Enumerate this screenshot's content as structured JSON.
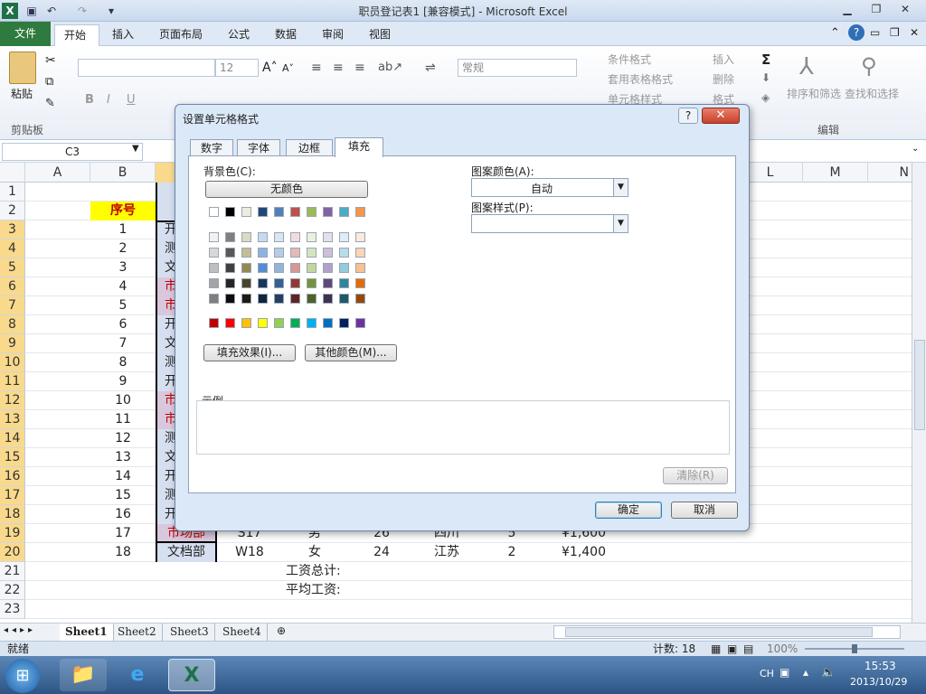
{
  "window": {
    "title": "职员登记表1  [兼容模式]  -  Microsoft Excel"
  },
  "tabs": {
    "file": "文件",
    "home": "开始",
    "insert": "插入",
    "layout": "页面布局",
    "formulas": "公式",
    "data": "数据",
    "review": "审阅",
    "view": "视图"
  },
  "ribbon": {
    "paste": "粘贴",
    "clipboard": "剪贴板",
    "font_size": "12",
    "number_format": "常规",
    "cond_format": "条件格式",
    "table_format": "套用表格格式",
    "cell_style": "单元格样式",
    "insert": "插入",
    "delete": "删除",
    "format": "格式",
    "sort_filter": "排序和筛选",
    "find_select": "查找和选择",
    "editing": "编辑",
    "bold": "B",
    "italic": "I",
    "underline": "U"
  },
  "formula": {
    "name_box": "C3"
  },
  "grid": {
    "cols": [
      "A",
      "B",
      "C",
      "",
      "",
      "",
      "",
      "",
      "",
      "L",
      "M",
      "N"
    ],
    "header_seq": "序号",
    "rows": [
      {
        "n": "1",
        "b": "",
        "c": ""
      },
      {
        "n": "2",
        "b": "序号",
        "c": ""
      },
      {
        "n": "3",
        "b": "1",
        "c": "开"
      },
      {
        "n": "4",
        "b": "2",
        "c": "测"
      },
      {
        "n": "5",
        "b": "3",
        "c": "文"
      },
      {
        "n": "6",
        "b": "4",
        "c": "市"
      },
      {
        "n": "7",
        "b": "5",
        "c": "市"
      },
      {
        "n": "8",
        "b": "6",
        "c": "开"
      },
      {
        "n": "9",
        "b": "7",
        "c": "文"
      },
      {
        "n": "10",
        "b": "8",
        "c": "测"
      },
      {
        "n": "11",
        "b": "9",
        "c": "开"
      },
      {
        "n": "12",
        "b": "10",
        "c": "市"
      },
      {
        "n": "13",
        "b": "11",
        "c": "市"
      },
      {
        "n": "14",
        "b": "12",
        "c": "测"
      },
      {
        "n": "15",
        "b": "13",
        "c": "文"
      },
      {
        "n": "16",
        "b": "14",
        "c": "开"
      },
      {
        "n": "17",
        "b": "15",
        "c": "测"
      },
      {
        "n": "18",
        "b": "16",
        "c": "开"
      },
      {
        "n": "19",
        "b": "17",
        "c": "市场部",
        "d": "S17",
        "e": "男",
        "f": "26",
        "g": "四川",
        "h": "5",
        "i": "¥1,600"
      },
      {
        "n": "20",
        "b": "18",
        "c": "文档部",
        "d": "W18",
        "e": "女",
        "f": "24",
        "g": "江苏",
        "h": "2",
        "i": "¥1,400"
      },
      {
        "n": "21",
        "e": "工资总计:"
      },
      {
        "n": "22",
        "e": "平均工资:"
      },
      {
        "n": "23"
      }
    ]
  },
  "sheets": [
    "Sheet1",
    "Sheet2",
    "Sheet3",
    "Sheet4"
  ],
  "status": {
    "ready": "就绪",
    "count": "计数: 18",
    "zoom": "100%"
  },
  "taskbar": {
    "lang": "CH",
    "time": "15:53",
    "date": "2013/10/29"
  },
  "dialog": {
    "title": "设置单元格格式",
    "tabs": [
      "数字",
      "字体",
      "边框",
      "填充"
    ],
    "bg_color_label": "背景色(C):",
    "no_color": "无颜色",
    "pattern_color_label": "图案颜色(A):",
    "pattern_color_value": "自动",
    "pattern_style_label": "图案样式(P):",
    "fill_effects": "填充效果(I)...",
    "more_colors": "其他颜色(M)...",
    "sample": "示例",
    "clear": "清除(R)",
    "ok": "确定",
    "cancel": "取消",
    "colors": {
      "row1": [
        "#ffffff",
        "#000000",
        "#eeece1",
        "#1f497d",
        "#4f81bd",
        "#c0504d",
        "#9bbb59",
        "#8064a2",
        "#4bacc6",
        "#f79646"
      ],
      "tint": [
        [
          "#f2f2f2",
          "#7f7f7f",
          "#ddd9c3",
          "#c6d9f0",
          "#dbe5f1",
          "#f2dcdb",
          "#ebf1dd",
          "#e5e0ec",
          "#dbeef3",
          "#fdeada"
        ],
        [
          "#d8d8d8",
          "#595959",
          "#c4bd97",
          "#8db3e2",
          "#b8cce4",
          "#e5b9b7",
          "#d7e3bc",
          "#ccc1d9",
          "#b7dde8",
          "#fbd5b5"
        ],
        [
          "#bfbfbf",
          "#3f3f3f",
          "#938953",
          "#548dd4",
          "#95b3d7",
          "#d99694",
          "#c3d69b",
          "#b2a2c7",
          "#92cddc",
          "#fac08f"
        ],
        [
          "#a5a5a5",
          "#262626",
          "#494429",
          "#17365d",
          "#366092",
          "#953734",
          "#76923c",
          "#5f497a",
          "#31859b",
          "#e36c09"
        ],
        [
          "#7f7f7f",
          "#0c0c0c",
          "#1d1b10",
          "#0f243e",
          "#244061",
          "#632423",
          "#4f6128",
          "#3f3151",
          "#205867",
          "#974806"
        ]
      ],
      "standard": [
        "#c00000",
        "#ff0000",
        "#ffc000",
        "#ffff00",
        "#92d050",
        "#00b050",
        "#00b0f0",
        "#0070c0",
        "#002060",
        "#7030a0"
      ]
    }
  }
}
